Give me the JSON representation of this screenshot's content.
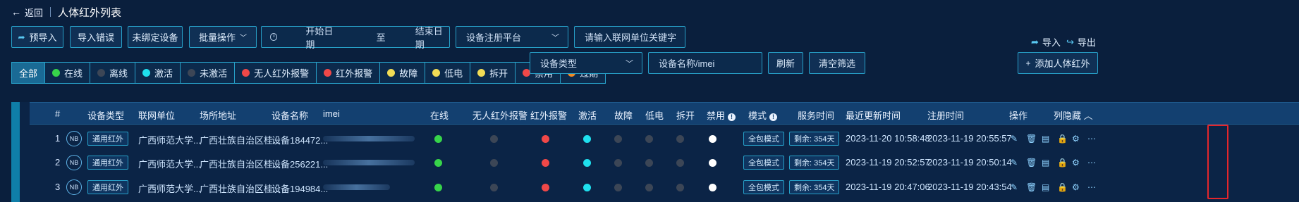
{
  "header": {
    "back_label": "返回",
    "title": "人体红外列表"
  },
  "toolbar": {
    "pre_import": "预导入",
    "import_error": "导入错误",
    "unbound_device": "未绑定设备",
    "batch_ops": "批量操作",
    "start_date": "开始日期",
    "date_sep": "至",
    "end_date": "结束日期",
    "platform_select": "设备注册平台",
    "keyword_placeholder": "请输入联网单位关键字",
    "import_label": "导入",
    "export_label": "导出"
  },
  "filters": [
    {
      "label": "全部",
      "dot": null,
      "active": true
    },
    {
      "label": "在线",
      "dot": "#37d44a"
    },
    {
      "label": "离线",
      "dot": "#3c4656"
    },
    {
      "label": "激活",
      "dot": "#1fe0ee"
    },
    {
      "label": "未激活",
      "dot": "#3c4656"
    },
    {
      "label": "无人红外报警",
      "dot": "#f04848"
    },
    {
      "label": "红外报警",
      "dot": "#f04848"
    },
    {
      "label": "故障",
      "dot": "#f2dc55"
    },
    {
      "label": "低电",
      "dot": "#f2dc55"
    },
    {
      "label": "拆开",
      "dot": "#f2dc55"
    },
    {
      "label": "禁用",
      "dot": "#f04848"
    },
    {
      "label": "过期",
      "dot": "#f08a24"
    }
  ],
  "filter_controls": {
    "device_type": "设备类型",
    "device_name_placeholder": "设备名称/imei",
    "refresh": "刷新",
    "clear": "清空筛选",
    "add": "添加人体红外"
  },
  "table": {
    "columns": {
      "index": "#",
      "device_type": "设备类型",
      "unit": "联网单位",
      "address": "场所地址",
      "device_name": "设备名称",
      "imei": "imei",
      "online": "在线",
      "no_person_alarm": "无人红外报警",
      "ir_alarm": "红外报警",
      "active": "激活",
      "fault": "故障",
      "low_power": "低电",
      "opened": "拆开",
      "disabled": "禁用",
      "mode": "模式",
      "service_time": "服务时间",
      "last_update": "最近更新时间",
      "register_time": "注册时间",
      "ops": "操作",
      "col_hide": "列隐藏"
    },
    "rows": [
      {
        "index": "1",
        "nb": "NB",
        "type_tag": "通用红外",
        "unit": "广西师范大学...",
        "address": "广西壮族自治区桂...",
        "device_name": "设备184472...",
        "online": "#37d44a",
        "no_person_alarm": "#3c4656",
        "ir_alarm": "#f04848",
        "active": "#1fe0ee",
        "fault": "#3c4656",
        "low_power": "#3c4656",
        "opened": "#3c4656",
        "disabled": "#ffffff",
        "mode": "全包模式",
        "service": "剩余: 354天",
        "last_update": "2023-11-20 10:58:48",
        "register_time": "2023-11-19 20:55:57"
      },
      {
        "index": "2",
        "nb": "NB",
        "type_tag": "通用红外",
        "unit": "广西师范大学...",
        "address": "广西壮族自治区桂...",
        "device_name": "设备256221...",
        "online": "#37d44a",
        "no_person_alarm": "#3c4656",
        "ir_alarm": "#f04848",
        "active": "#1fe0ee",
        "fault": "#3c4656",
        "low_power": "#3c4656",
        "opened": "#3c4656",
        "disabled": "#ffffff",
        "mode": "全包模式",
        "service": "剩余: 354天",
        "last_update": "2023-11-19 20:52:57",
        "register_time": "2023-11-19 20:50:14"
      },
      {
        "index": "3",
        "nb": "NB",
        "type_tag": "通用红外",
        "unit": "广西师范大学...",
        "address": "广西壮族自治区桂...",
        "device_name": "设备194984...",
        "online": "#37d44a",
        "no_person_alarm": "#3c4656",
        "ir_alarm": "#f04848",
        "active": "#1fe0ee",
        "fault": "#3c4656",
        "low_power": "#3c4656",
        "opened": "#3c4656",
        "disabled": "#ffffff",
        "mode": "全包模式",
        "service": "剩余: 354天",
        "last_update": "2023-11-19 20:47:06",
        "register_time": "2023-11-19 20:43:54"
      }
    ]
  },
  "colors": {
    "accent": "#27a0c8",
    "background": "#0a1f3d",
    "highlight": "#e4262b"
  }
}
